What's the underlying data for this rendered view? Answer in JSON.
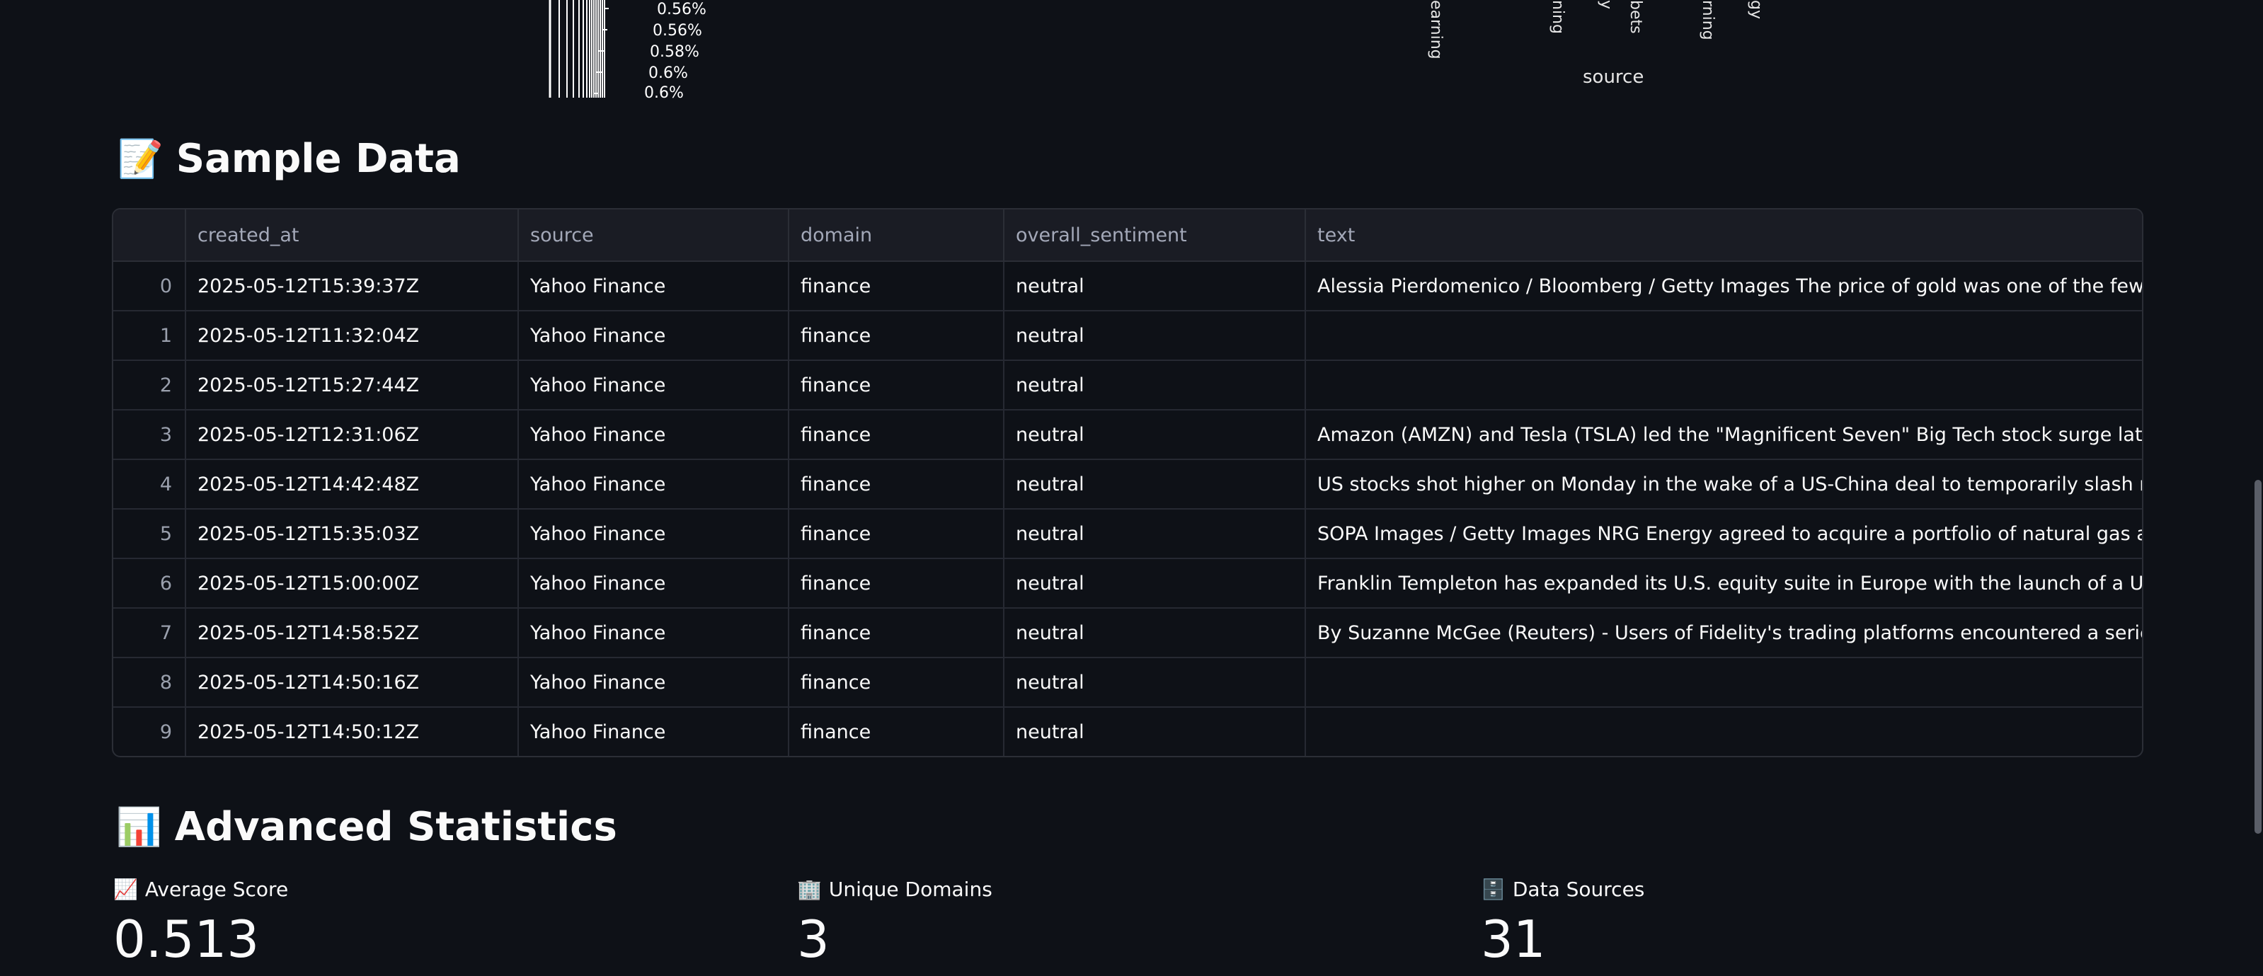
{
  "top_left_chart": {
    "percent_labels": [
      "0.56%",
      "0.56%",
      "0.58%",
      "0.6%",
      "0.6%"
    ]
  },
  "top_right_chart": {
    "tick_fragments": [
      "earning",
      "ning",
      "y",
      "bets",
      "rning",
      "gy"
    ],
    "x_axis_title": "source"
  },
  "sample_data": {
    "emoji": "📝",
    "title": "Sample Data",
    "columns": [
      "",
      "created_at",
      "source",
      "domain",
      "overall_sentiment",
      "text"
    ],
    "rows": [
      [
        "0",
        "2025-05-12T15:39:37Z",
        "Yahoo Finance",
        "finance",
        "neutral",
        "Alessia Pierdomenico / Bloomberg / Getty Images The price of gold was one of the few declining asse"
      ],
      [
        "1",
        "2025-05-12T11:32:04Z",
        "Yahoo Finance",
        "finance",
        "neutral",
        ""
      ],
      [
        "2",
        "2025-05-12T15:27:44Z",
        "Yahoo Finance",
        "finance",
        "neutral",
        ""
      ],
      [
        "3",
        "2025-05-12T12:31:06Z",
        "Yahoo Finance",
        "finance",
        "neutral",
        "Amazon (AMZN) and Tesla (TSLA) led the \"Magnificent Seven\" Big Tech stock surge late Monday morn"
      ],
      [
        "4",
        "2025-05-12T14:42:48Z",
        "Yahoo Finance",
        "finance",
        "neutral",
        "US stocks shot higher on Monday in the wake of a US-China deal to temporarily slash reciprocal tariff"
      ],
      [
        "5",
        "2025-05-12T15:35:03Z",
        "Yahoo Finance",
        "finance",
        "neutral",
        "SOPA Images / Getty Images NRG Energy agreed to acquire a portfolio of natural gas assets from LS P"
      ],
      [
        "6",
        "2025-05-12T15:00:00Z",
        "Yahoo Finance",
        "finance",
        "neutral",
        "Franklin Templeton has expanded its U.S. equity suite in Europe with the launch of a U.S. megacap ET"
      ],
      [
        "7",
        "2025-05-12T14:58:52Z",
        "Yahoo Finance",
        "finance",
        "neutral",
        "By Suzanne McGee  (Reuters) - Users of Fidelity's trading platforms encountered a series of glitches th"
      ],
      [
        "8",
        "2025-05-12T14:50:16Z",
        "Yahoo Finance",
        "finance",
        "neutral",
        ""
      ],
      [
        "9",
        "2025-05-12T14:50:12Z",
        "Yahoo Finance",
        "finance",
        "neutral",
        ""
      ]
    ]
  },
  "advanced_statistics": {
    "emoji": "📊",
    "title": "Advanced Statistics",
    "metrics": [
      {
        "icon": "📈",
        "label": "Average Score",
        "value": "0.513"
      },
      {
        "icon": "🏢",
        "label": "Unique Domains",
        "value": "3"
      },
      {
        "icon": "🗄️",
        "label": "Data Sources",
        "value": "31"
      }
    ]
  },
  "colors": {
    "background": "#0e1117",
    "header_bg": "#1a1c24",
    "border": "#2b2e36",
    "muted_text": "#a3a8b8"
  }
}
